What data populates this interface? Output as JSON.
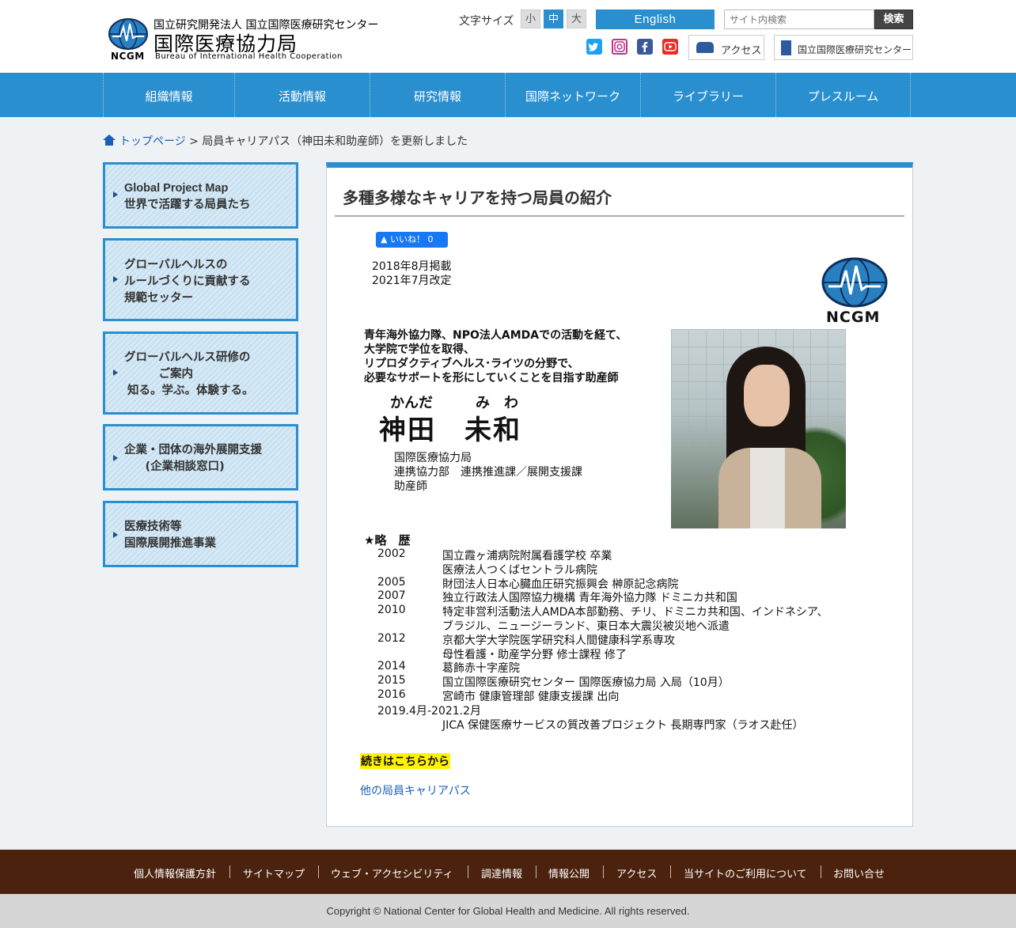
{
  "header": {
    "logo_org": "国立研究開発法人 国立国際医療研究センター",
    "logo_title": "国際医療協力局",
    "logo_en": "Bureau of International Health Cooperation",
    "logo_abbr": "NCGM",
    "fontsize_label": "文字サイズ",
    "fontsize_small": "小",
    "fontsize_mid": "中",
    "fontsize_large": "大",
    "english_label": "English",
    "search_placeholder": "サイト内検索",
    "search_button": "検索",
    "access_label": "アクセス",
    "ncgm_label": "国立国際医療研究センター"
  },
  "nav": {
    "items": [
      {
        "label": "組織情報"
      },
      {
        "label": "活動情報"
      },
      {
        "label": "研究情報"
      },
      {
        "label": "国際ネットワーク"
      },
      {
        "label": "ライブラリー"
      },
      {
        "label": "プレスルーム"
      }
    ]
  },
  "breadcrumb": {
    "home": "トップページ",
    "sep": " > ",
    "current": "局員キャリアパス（神田未和助産師）を更新しました"
  },
  "sidebar": {
    "items": [
      {
        "lines": [
          "Global Project Map",
          "世界で活躍する局員たち"
        ]
      },
      {
        "lines": [
          "グローバルヘルスの",
          "ルールづくりに貢献する",
          "規範セッター"
        ]
      },
      {
        "lines": [
          "グローバルヘルス研修の",
          "　　　ご案内",
          "知る。学ぶ。体験する。"
        ]
      },
      {
        "lines": [
          "企業・団体の海外展開支援",
          "　(企業相談窓口)"
        ]
      },
      {
        "lines": [
          "医療技術等",
          "国際展開推進事業"
        ]
      }
    ]
  },
  "main": {
    "title": "多種多様なキャリアを持つ局員の紹介",
    "like_label": "いいね！ 0",
    "date_posted": "2018年8月掲載",
    "date_revised": "2021年7月改定",
    "card_logo": "NCGM",
    "intro_lines": [
      "青年海外協力隊、NPO法人AMDAでの活動を経て、",
      "大学院で学位を取得、",
      "リプロダクティブヘルス･ライツの分野で、",
      "必要なサポートを形にしていくことを目指す助産師"
    ],
    "name_kana": "かんだ　　　み　わ",
    "name": "神田　未和",
    "affiliation": [
      "国際医療協力局",
      "連携協力部　連携推進課／展開支援課",
      "助産師"
    ],
    "career_heading": "★略　歴",
    "career": [
      {
        "year": "2002",
        "desc": "国立霞ヶ浦病院附属看護学校 卒業"
      },
      {
        "year": "",
        "desc": "医療法人つくばセントラル病院"
      },
      {
        "year": "2005",
        "desc": "財団法人日本心臓血圧研究振興会 榊原記念病院"
      },
      {
        "year": "2007",
        "desc": "独立行政法人国際協力機構 青年海外協力隊 ドミニカ共和国"
      },
      {
        "year": "2010",
        "desc": "特定非営利活動法人AMDA本部勤務、チリ、ドミニカ共和国、インドネシア、"
      },
      {
        "year": "",
        "desc": "ブラジル、ニュージーランド、東日本大震災被災地へ派遣"
      },
      {
        "year": "2012",
        "desc": "京都大学大学院医学研究科人間健康科学系専攻"
      },
      {
        "year": "",
        "desc": "母性看護・助産学分野 修士課程 修了"
      },
      {
        "year": "2014",
        "desc": "葛飾赤十字産院"
      },
      {
        "year": "2015",
        "desc": "国立国際医療研究センター 国際医療協力局 入局（10月）"
      },
      {
        "year": "2016",
        "desc": "宮崎市 健康管理部 健康支援課 出向"
      },
      {
        "year": "2019.4月-2021.2月",
        "desc": ""
      },
      {
        "year": "",
        "desc": "JICA 保健医療サービスの質改善プロジェクト 長期専門家（ラオス赴任）"
      }
    ],
    "more_link": "続きはこちらから",
    "other_link": "他の局員キャリアパス"
  },
  "footer": {
    "items": [
      {
        "label": "個人情報保護方針"
      },
      {
        "label": "サイトマップ"
      },
      {
        "label": "ウェブ・アクセシビリティ"
      },
      {
        "label": "調達情報"
      },
      {
        "label": "情報公開"
      },
      {
        "label": "アクセス"
      },
      {
        "label": "当サイトのご利用について"
      },
      {
        "label": "お問い合せ"
      }
    ],
    "copyright": "Copyright © National Center for Global Health and Medicine. All rights reserved."
  },
  "colors": {
    "brand_blue": "#2a8fcf",
    "footer_brown": "#4a220e",
    "highlight": "#fff200"
  }
}
